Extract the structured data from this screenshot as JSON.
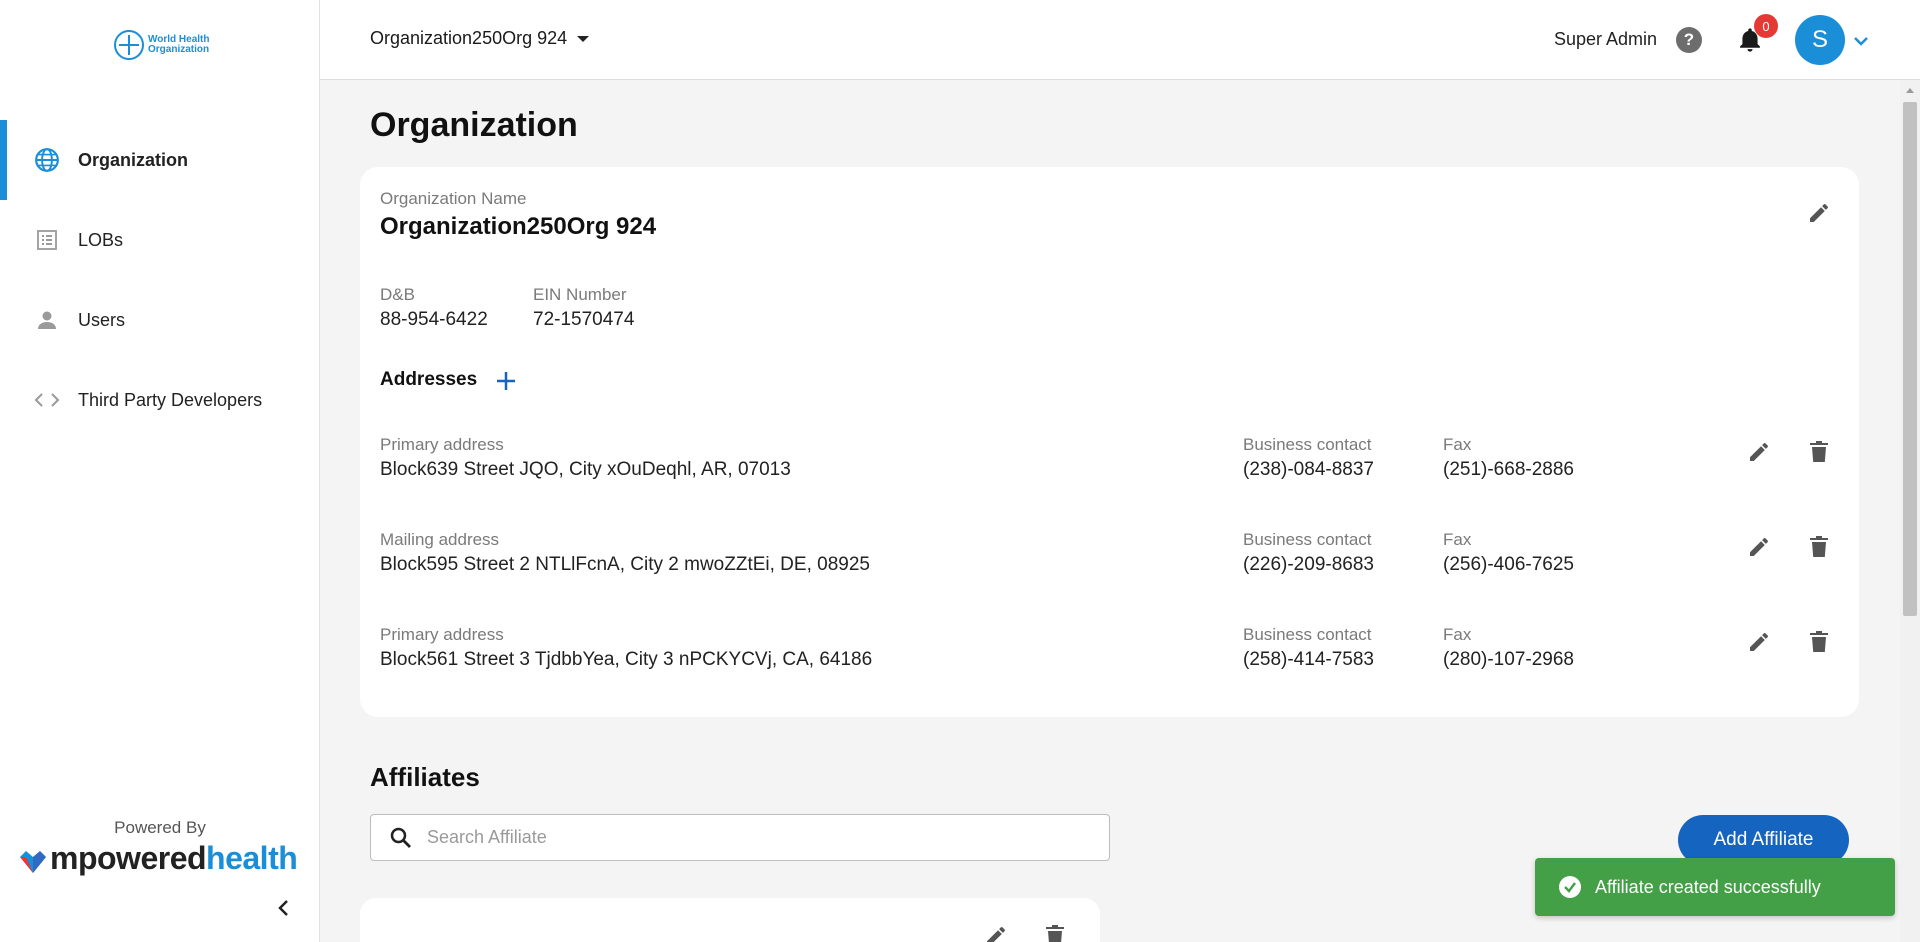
{
  "sidebar": {
    "logo_text": [
      "World Health",
      "Organization"
    ],
    "items": [
      {
        "label": "Organization",
        "icon": "globe-icon",
        "active": true
      },
      {
        "label": "LOBs",
        "icon": "list-icon",
        "active": false
      },
      {
        "label": "Users",
        "icon": "person-icon",
        "active": false
      },
      {
        "label": "Third Party Developers",
        "icon": "code-icon",
        "active": false
      }
    ],
    "powered_by": "Powered By",
    "brand_part1": "mpowered",
    "brand_part2": "health"
  },
  "topbar": {
    "org_selector": "Organization250Org 924",
    "user_role": "Super Admin",
    "help_glyph": "?",
    "notification_count": "0",
    "avatar_initial": "S"
  },
  "main": {
    "page_title": "Organization",
    "org": {
      "name_label": "Organization Name",
      "name_value": "Organization250Org 924",
      "dnb_label": "D&B",
      "dnb_value": "88-954-6422",
      "ein_label": "EIN Number",
      "ein_value": "72-1570474"
    },
    "addresses_title": "Addresses",
    "addresses": [
      {
        "type": "Primary address",
        "address": "Block639 Street JQO, City xOuDeqhl, AR, 07013",
        "contact_label": "Business contact",
        "contact": "(238)-084-8837",
        "fax_label": "Fax",
        "fax": "(251)-668-2886"
      },
      {
        "type": "Mailing address",
        "address": "Block595 Street 2 NTLlFcnA, City 2 mwoZZtEi, DE, 08925",
        "contact_label": "Business contact",
        "contact": "(226)-209-8683",
        "fax_label": "Fax",
        "fax": "(256)-406-7625"
      },
      {
        "type": "Primary address",
        "address": "Block561 Street 3 TjdbbYea, City 3 nPCKYCVj, CA, 64186",
        "contact_label": "Business contact",
        "contact": "(258)-414-7583",
        "fax_label": "Fax",
        "fax": "(280)-107-2968"
      }
    ],
    "affiliates_title": "Affiliates",
    "search_placeholder": "Search Affiliate",
    "add_affiliate_label": "Add Affiliate"
  },
  "toast": {
    "message": "Affiliate created successfully",
    "color": "#43a047"
  },
  "colors": {
    "accent": "#1a8fd8",
    "primary_button": "#1565c0",
    "badge": "#e53935"
  }
}
